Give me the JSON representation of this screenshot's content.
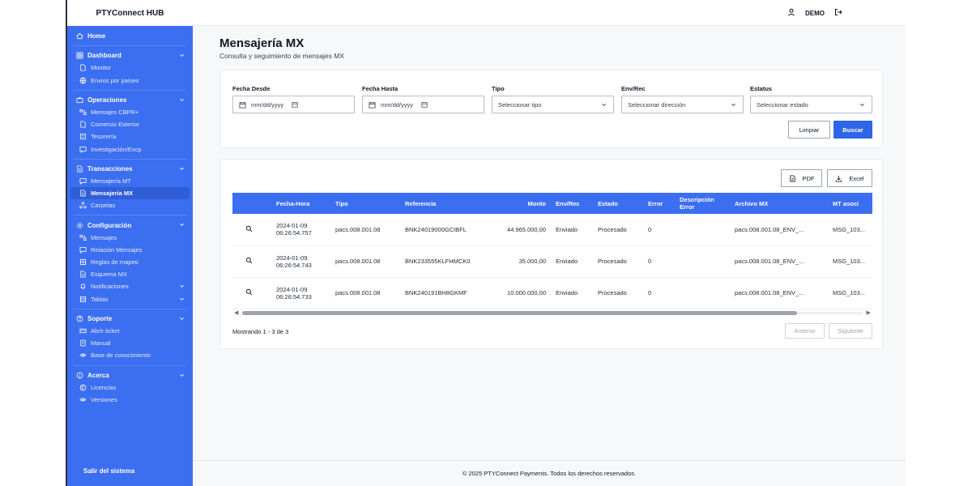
{
  "app": {
    "brand": "PTYConnect HUB",
    "user": "DEMO"
  },
  "sidebar": {
    "sections": [
      {
        "label": "Home",
        "icon": "home-icon",
        "items": []
      },
      {
        "label": "Dashboard",
        "icon": "dashboard-icon",
        "items": [
          "Monitor",
          "Envios por países"
        ]
      },
      {
        "label": "Operaciones",
        "icon": "briefcase-icon",
        "items": [
          "Mensajes CBPR+",
          "Comercio Exterior",
          "Tesorería",
          "Investigación/Excp"
        ]
      },
      {
        "label": "Transacciones",
        "icon": "document-icon",
        "items": [
          "Mensajería MT",
          "Mensajería MX",
          "Carpetas"
        ]
      },
      {
        "label": "Configuración",
        "icon": "gear-icon",
        "items": [
          "Mensajes",
          "Relación Mensajes",
          "Reglas de mapeo",
          "Esquema MX",
          "Notificaciones",
          "Tablas"
        ]
      },
      {
        "label": "Soporte",
        "icon": "help-icon",
        "items": [
          "Abrir ticket",
          "Manual",
          "Base de conocimiento"
        ]
      },
      {
        "label": "Acerca",
        "icon": "info-icon",
        "items": [
          "Licencias",
          "Versiones"
        ]
      }
    ],
    "logout": "Salir del sistema"
  },
  "page": {
    "title": "Mensajería MX",
    "subtitle": "Consulta y seguimiento de mensajes MX"
  },
  "filters": {
    "fecha_desde": {
      "label": "Fecha Desde",
      "placeholder": "mm/dd/yyyy"
    },
    "fecha_hasta": {
      "label": "Fecha Hasta",
      "placeholder": "mm/dd/yyyy"
    },
    "tipo": {
      "label": "Tipo",
      "value": "Seleccionar tipo"
    },
    "envrec": {
      "label": "Env/Rec",
      "value": "Seleccionar dirección"
    },
    "estatus": {
      "label": "Estatus",
      "value": "Seleccionar estado"
    },
    "clear_label": "Limpiar",
    "search_label": "Buscar"
  },
  "export": {
    "pdf": "PDF",
    "excel": "Excel"
  },
  "table": {
    "headers": [
      "",
      "Fecha-Hora",
      "Tipo",
      "Referencia",
      "Monto",
      "Env/Rec",
      "Estado",
      "Error",
      "Descripción Error",
      "Archivo MX",
      "MT asoci"
    ],
    "rows": [
      {
        "fecha": "2024-01-09",
        "hora": "06:26:54.757",
        "tipo": "pacs.008.001.08",
        "referencia": "BNK24019000GCIBFL",
        "monto": "44.965.000,00",
        "envrec": "Enviado",
        "estado": "Procesado",
        "error": "0",
        "descripcion": "",
        "archivo": "pacs.008.001.08_ENV_...",
        "mt": "MSG_103..."
      },
      {
        "fecha": "2024-01-09",
        "hora": "06:26:54.743",
        "tipo": "pacs.008.001.08",
        "referencia": "BNK233555KLFHMCK0",
        "monto": "35.000,00",
        "envrec": "Enviado",
        "estado": "Procesado",
        "error": "0",
        "descripcion": "",
        "archivo": "pacs.008.001.08_ENV_...",
        "mt": "MSG_103..."
      },
      {
        "fecha": "2024-01-09",
        "hora": "06:26:54.733",
        "tipo": "pacs.008.001.08",
        "referencia": "BNK240191BH8GKMF",
        "monto": "10.000.000,00",
        "envrec": "Enviado",
        "estado": "Procesado",
        "error": "0",
        "descripcion": "",
        "archivo": "pacs.008.001.08_ENV_...",
        "mt": "MSG_103..."
      }
    ]
  },
  "pagination": {
    "showing": "Mostrando 1 - 3 de 3",
    "prev": "Anterior",
    "next": "Siguiente"
  },
  "footer": {
    "text": "© 2025 PTYConnect Payments. Todos los derechos reservados."
  },
  "colors": {
    "sidebar": "#3b6ef0",
    "primary": "#2f66e8",
    "active_item": "#2f5ed6"
  }
}
